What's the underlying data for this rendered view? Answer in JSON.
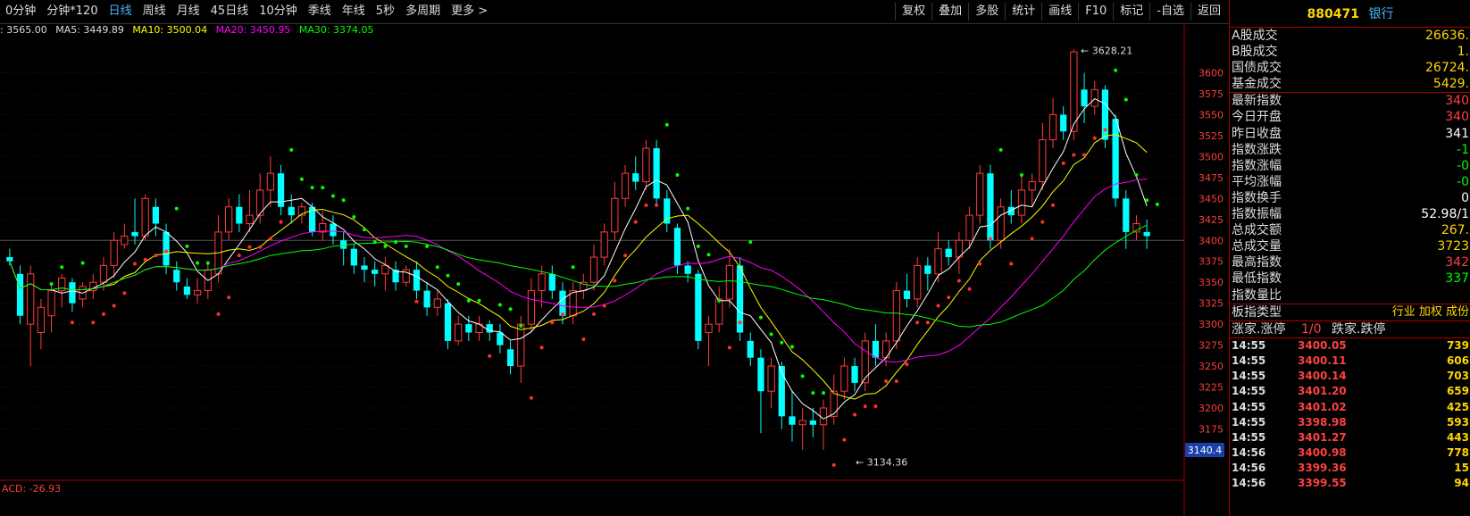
{
  "toolbar": {
    "periods": [
      "0分钟",
      "分钟*120",
      "日线",
      "周线",
      "月线",
      "45日线",
      "10分钟",
      "季线",
      "年线",
      "5秒",
      "多周期",
      "更多 >"
    ],
    "active_period": "日线",
    "buttons": [
      "复权",
      "叠加",
      "多股",
      "统计",
      "画线",
      "F10",
      "标记",
      "-自选",
      "返回"
    ]
  },
  "ma": {
    "close": ": 3565.00",
    "ma5": "MA5: 3449.89",
    "ma10": "MA10: 3500.04",
    "ma20": "MA20: 3450.95",
    "ma30": "MA30: 3374.05"
  },
  "colors": {
    "up": "#ff3c3c",
    "down": "#00ffff",
    "ma5": "#ffffff",
    "ma10": "#ffff00",
    "ma20": "#ff00ff",
    "ma30": "#00ff00",
    "sar_up": "#ff3030",
    "sar_down": "#00ff00",
    "grid": "#600000"
  },
  "chart": {
    "price_ticks": [
      "3600",
      "3575",
      "3550",
      "3525",
      "3500",
      "3475",
      "3450",
      "3425",
      "3400",
      "3375",
      "3350",
      "3325",
      "3300",
      "3275",
      "3250",
      "3225",
      "3200",
      "3175"
    ],
    "current_price": "3140.4",
    "high_label": "3628.21",
    "low_label": "3134.36",
    "macd_label": "ACD: -26.93"
  },
  "chart_data": {
    "type": "candlestick",
    "ylim": [
      3135,
      3640
    ],
    "candles": [
      [
        3380,
        3375,
        3390,
        3370
      ],
      [
        3360,
        3310,
        3370,
        3300
      ],
      [
        3300,
        3360,
        3370,
        3250
      ],
      [
        3290,
        3320,
        3330,
        3270
      ],
      [
        3310,
        3340,
        3350,
        3290
      ],
      [
        3340,
        3355,
        3360,
        3320
      ],
      [
        3350,
        3325,
        3355,
        3315
      ],
      [
        3330,
        3345,
        3350,
        3320
      ],
      [
        3340,
        3350,
        3360,
        3330
      ],
      [
        3350,
        3370,
        3380,
        3340
      ],
      [
        3370,
        3400,
        3410,
        3355
      ],
      [
        3395,
        3405,
        3420,
        3390
      ],
      [
        3410,
        3405,
        3450,
        3395
      ],
      [
        3405,
        3450,
        3455,
        3400
      ],
      [
        3440,
        3420,
        3450,
        3405
      ],
      [
        3410,
        3370,
        3420,
        3360
      ],
      [
        3365,
        3350,
        3375,
        3340
      ],
      [
        3345,
        3335,
        3355,
        3330
      ],
      [
        3335,
        3340,
        3355,
        3325
      ],
      [
        3340,
        3365,
        3375,
        3330
      ],
      [
        3360,
        3410,
        3430,
        3350
      ],
      [
        3410,
        3440,
        3450,
        3400
      ],
      [
        3440,
        3420,
        3455,
        3410
      ],
      [
        3420,
        3430,
        3460,
        3410
      ],
      [
        3430,
        3460,
        3480,
        3420
      ],
      [
        3460,
        3480,
        3500,
        3440
      ],
      [
        3480,
        3440,
        3490,
        3430
      ],
      [
        3440,
        3430,
        3455,
        3420
      ],
      [
        3430,
        3440,
        3445,
        3420
      ],
      [
        3440,
        3410,
        3445,
        3405
      ],
      [
        3410,
        3420,
        3435,
        3400
      ],
      [
        3420,
        3405,
        3430,
        3395
      ],
      [
        3400,
        3390,
        3410,
        3370
      ],
      [
        3390,
        3370,
        3395,
        3360
      ],
      [
        3370,
        3365,
        3380,
        3350
      ],
      [
        3365,
        3360,
        3375,
        3345
      ],
      [
        3360,
        3370,
        3380,
        3340
      ],
      [
        3365,
        3350,
        3375,
        3340
      ],
      [
        3350,
        3365,
        3370,
        3345
      ],
      [
        3365,
        3340,
        3375,
        3330
      ],
      [
        3340,
        3320,
        3350,
        3310
      ],
      [
        3320,
        3330,
        3340,
        3310
      ],
      [
        3325,
        3280,
        3330,
        3270
      ],
      [
        3280,
        3300,
        3310,
        3275
      ],
      [
        3300,
        3290,
        3310,
        3280
      ],
      [
        3290,
        3300,
        3310,
        3280
      ],
      [
        3300,
        3290,
        3305,
        3280
      ],
      [
        3290,
        3275,
        3300,
        3265
      ],
      [
        3270,
        3250,
        3280,
        3240
      ],
      [
        3250,
        3300,
        3310,
        3230
      ],
      [
        3300,
        3340,
        3355,
        3290
      ],
      [
        3340,
        3360,
        3370,
        3320
      ],
      [
        3360,
        3340,
        3370,
        3330
      ],
      [
        3340,
        3310,
        3350,
        3300
      ],
      [
        3310,
        3340,
        3350,
        3300
      ],
      [
        3340,
        3350,
        3360,
        3330
      ],
      [
        3350,
        3380,
        3395,
        3340
      ],
      [
        3380,
        3410,
        3420,
        3370
      ],
      [
        3410,
        3450,
        3470,
        3400
      ],
      [
        3450,
        3480,
        3490,
        3440
      ],
      [
        3480,
        3470,
        3500,
        3460
      ],
      [
        3470,
        3510,
        3520,
        3460
      ],
      [
        3510,
        3450,
        3520,
        3440
      ],
      [
        3450,
        3420,
        3460,
        3410
      ],
      [
        3415,
        3370,
        3420,
        3360
      ],
      [
        3370,
        3360,
        3375,
        3350
      ],
      [
        3360,
        3280,
        3365,
        3270
      ],
      [
        3290,
        3300,
        3310,
        3250
      ],
      [
        3300,
        3330,
        3345,
        3290
      ],
      [
        3330,
        3370,
        3390,
        3320
      ],
      [
        3370,
        3290,
        3380,
        3280
      ],
      [
        3280,
        3260,
        3290,
        3250
      ],
      [
        3260,
        3220,
        3270,
        3170
      ],
      [
        3220,
        3250,
        3260,
        3200
      ],
      [
        3250,
        3190,
        3255,
        3175
      ],
      [
        3190,
        3180,
        3220,
        3160
      ],
      [
        3180,
        3185,
        3200,
        3150
      ],
      [
        3185,
        3180,
        3200,
        3165
      ],
      [
        3180,
        3200,
        3210,
        3150
      ],
      [
        3190,
        3220,
        3240,
        3180
      ],
      [
        3220,
        3250,
        3260,
        3210
      ],
      [
        3250,
        3230,
        3260,
        3220
      ],
      [
        3230,
        3280,
        3290,
        3220
      ],
      [
        3280,
        3260,
        3300,
        3250
      ],
      [
        3260,
        3280,
        3290,
        3250
      ],
      [
        3280,
        3340,
        3350,
        3270
      ],
      [
        3340,
        3330,
        3360,
        3320
      ],
      [
        3330,
        3370,
        3380,
        3320
      ],
      [
        3370,
        3360,
        3380,
        3340
      ],
      [
        3360,
        3390,
        3410,
        3350
      ],
      [
        3390,
        3380,
        3400,
        3370
      ],
      [
        3380,
        3400,
        3410,
        3360
      ],
      [
        3400,
        3430,
        3440,
        3390
      ],
      [
        3430,
        3480,
        3490,
        3420
      ],
      [
        3480,
        3400,
        3490,
        3390
      ],
      [
        3400,
        3440,
        3450,
        3390
      ],
      [
        3440,
        3430,
        3460,
        3420
      ],
      [
        3430,
        3460,
        3480,
        3420
      ],
      [
        3460,
        3470,
        3480,
        3440
      ],
      [
        3470,
        3520,
        3540,
        3460
      ],
      [
        3520,
        3550,
        3570,
        3510
      ],
      [
        3550,
        3530,
        3560,
        3520
      ],
      [
        3530,
        3625,
        3628,
        3520
      ],
      [
        3580,
        3560,
        3600,
        3540
      ],
      [
        3560,
        3580,
        3590,
        3550
      ],
      [
        3580,
        3520,
        3585,
        3510
      ],
      [
        3545,
        3450,
        3550,
        3440
      ],
      [
        3450,
        3410,
        3460,
        3390
      ],
      [
        3410,
        3420,
        3430,
        3400
      ],
      [
        3410,
        3405,
        3425,
        3390
      ]
    ]
  },
  "panel": {
    "code": "880471",
    "name": "银行",
    "rows1": [
      {
        "label": "A股成交",
        "value": "26636.",
        "color": "#ffd700"
      },
      {
        "label": "B股成交",
        "value": "1.",
        "color": "#ffd700"
      },
      {
        "label": "国债成交",
        "value": "26724.",
        "color": "#ffd700"
      },
      {
        "label": "基金成交",
        "value": "5429.",
        "color": "#ffd700"
      }
    ],
    "rows2": [
      {
        "label": "最新指数",
        "value": "340",
        "color": "#ff4040"
      },
      {
        "label": "今日开盘",
        "value": "340",
        "color": "#ff4040"
      },
      {
        "label": "昨日收盘",
        "value": "341",
        "color": "#ffffff"
      },
      {
        "label": "指数涨跌",
        "value": "-1",
        "color": "#00ff00"
      },
      {
        "label": "指数涨幅",
        "value": "-0",
        "color": "#00ff00"
      },
      {
        "label": "平均涨幅",
        "value": "-0",
        "color": "#00ff00"
      },
      {
        "label": "指数换手",
        "value": "0",
        "color": "#ffffff"
      },
      {
        "label": "指数振幅",
        "value": "52.98/1",
        "color": "#ffffff"
      },
      {
        "label": "总成交额",
        "value": "267.",
        "color": "#ffd700"
      },
      {
        "label": "总成交量",
        "value": "3723",
        "color": "#ffd700"
      },
      {
        "label": "最高指数",
        "value": "342",
        "color": "#ff4040"
      },
      {
        "label": "最低指数",
        "value": "337",
        "color": "#00ff00"
      },
      {
        "label": "指数量比",
        "value": "",
        "color": "#ffffff"
      }
    ],
    "type_row": {
      "label": "板指类型",
      "value": "行业 加权 成份"
    },
    "limit_row": {
      "a": "涨家.涨停",
      "b": "1/0",
      "c": "跌家.跌停"
    },
    "ticks": [
      {
        "t": "14:55",
        "p": "3400.05",
        "v": "739"
      },
      {
        "t": "14:55",
        "p": "3400.11",
        "v": "606"
      },
      {
        "t": "14:55",
        "p": "3400.14",
        "v": "703"
      },
      {
        "t": "14:55",
        "p": "3401.20",
        "v": "659"
      },
      {
        "t": "14:55",
        "p": "3401.02",
        "v": "425"
      },
      {
        "t": "14:55",
        "p": "3398.98",
        "v": "593"
      },
      {
        "t": "14:55",
        "p": "3401.27",
        "v": "443"
      },
      {
        "t": "14:56",
        "p": "3400.98",
        "v": "778"
      },
      {
        "t": "14:56",
        "p": "3399.36",
        "v": "15"
      },
      {
        "t": "14:56",
        "p": "3399.55",
        "v": "94"
      }
    ]
  }
}
